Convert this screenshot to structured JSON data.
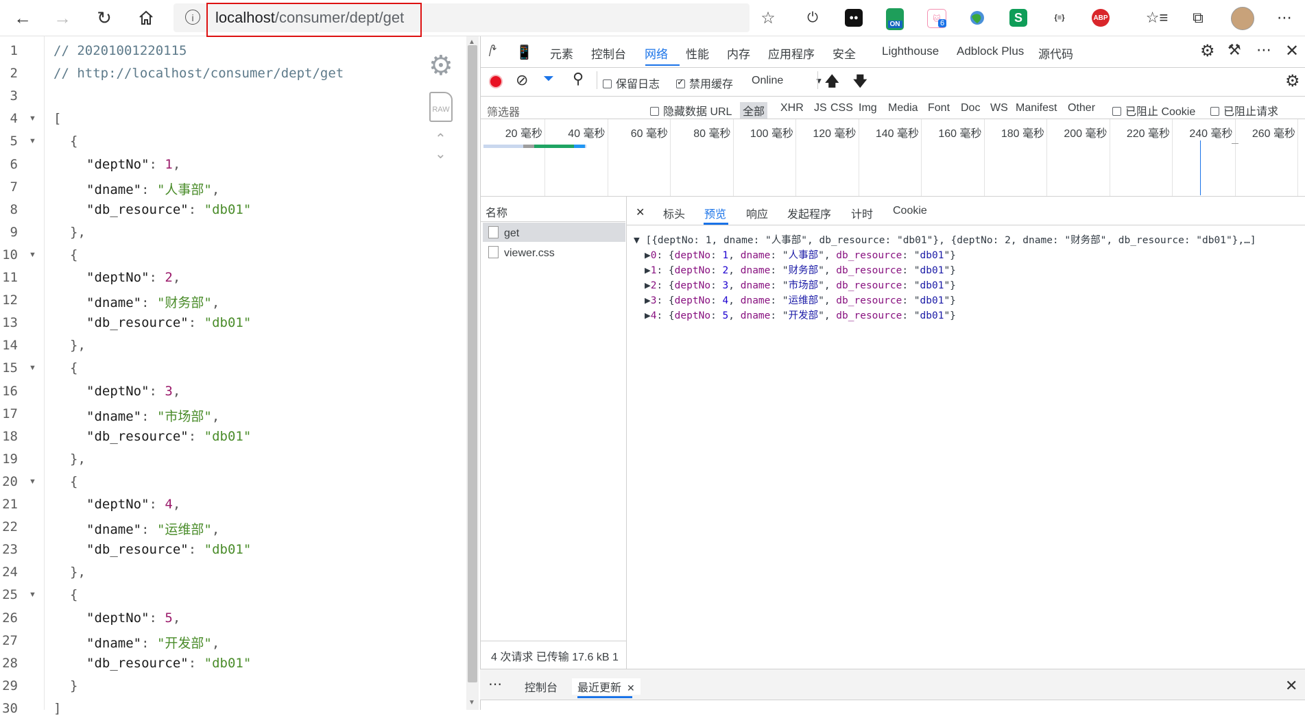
{
  "toolbar": {
    "address_host": "localhost",
    "address_path": "/consumer/dept/get",
    "ext_badge_on": "ON",
    "ext_badge_count": "6",
    "ext_json_label": "{≡}",
    "ext_abp_label": "ABP"
  },
  "editor": {
    "comment_timestamp": "// 20201001220115",
    "comment_url": "// http://localhost/consumer/dept/get",
    "key_dept_no": "\"deptNo\"",
    "key_dname": "\"dname\"",
    "key_db_resource": "\"db_resource\"",
    "open_bracket": "[",
    "close_bracket": "]",
    "open_brace": "{",
    "close_brace_comma": "},",
    "close_brace": "}",
    "colon": ":",
    "comma": ",",
    "raw_label": "RAW",
    "records": [
      {
        "deptNo": "1",
        "dname": "\"人事部\"",
        "db_resource": "\"db01\""
      },
      {
        "deptNo": "2",
        "dname": "\"财务部\"",
        "db_resource": "\"db01\""
      },
      {
        "deptNo": "3",
        "dname": "\"市场部\"",
        "db_resource": "\"db01\""
      },
      {
        "deptNo": "4",
        "dname": "\"运维部\"",
        "db_resource": "\"db01\""
      },
      {
        "deptNo": "5",
        "dname": "\"开发部\"",
        "db_resource": "\"db01\""
      }
    ],
    "line_numbers": [
      "1",
      "2",
      "3",
      "4",
      "5",
      "6",
      "7",
      "8",
      "9",
      "10",
      "11",
      "12",
      "13",
      "14",
      "15",
      "16",
      "17",
      "18",
      "19",
      "20",
      "21",
      "22",
      "23",
      "24",
      "25",
      "26",
      "27",
      "28",
      "29",
      "30"
    ]
  },
  "devtools": {
    "tabs": [
      "元素",
      "控制台",
      "网络",
      "性能",
      "内存",
      "应用程序",
      "安全",
      "Lighthouse",
      "Adblock Plus",
      "源代码"
    ],
    "active_tab": "网络",
    "preserve_log": "保留日志",
    "disable_cache": "禁用缓存",
    "throttle": "Online",
    "filter_placeholder": "筛选器",
    "hide_data_urls": "隐藏数据 URL",
    "type_filters": [
      "全部",
      "XHR",
      "JS",
      "CSS",
      "Img",
      "Media",
      "Font",
      "Doc",
      "WS",
      "Manifest",
      "Other"
    ],
    "blocked_cookies": "已阻止 Cookie",
    "blocked_requests": "已阻止请求",
    "timeline_ticks": [
      "20 毫秒",
      "40 毫秒",
      "60 毫秒",
      "80 毫秒",
      "100 毫秒",
      "120 毫秒",
      "140 毫秒",
      "160 毫秒",
      "180 毫秒",
      "200 毫秒",
      "220 毫秒",
      "240 毫秒",
      "260 毫秒"
    ],
    "name_header": "名称",
    "requests": [
      "get",
      "viewer.css"
    ],
    "detail_tabs": [
      "标头",
      "预览",
      "响应",
      "发起程序",
      "计时",
      "Cookie"
    ],
    "active_detail_tab": "预览",
    "preview_summary": "▼ [{deptNo: 1, dname: \"人事部\", db_resource: \"db01\"}, {deptNo: 2, dname: \"财务部\", db_resource: \"db01\"},…]",
    "preview_items": [
      {
        "index": "0",
        "deptNo": "1",
        "dname": "人事部",
        "db": "db01"
      },
      {
        "index": "1",
        "deptNo": "2",
        "dname": "财务部",
        "db": "db01"
      },
      {
        "index": "2",
        "deptNo": "3",
        "dname": "市场部",
        "db": "db01"
      },
      {
        "index": "3",
        "deptNo": "4",
        "dname": "运维部",
        "db": "db01"
      },
      {
        "index": "4",
        "deptNo": "5",
        "dname": "开发部",
        "db": "db01"
      }
    ],
    "status_bar": "4 次请求  已传输 17.6 kB  1",
    "drawer_tabs": [
      "控制台",
      "最近更新"
    ],
    "drawer_active": "最近更新"
  },
  "colors": {
    "accent": "#1a73e8",
    "record_red": "#e81123",
    "highlight_red": "#dd1111"
  }
}
